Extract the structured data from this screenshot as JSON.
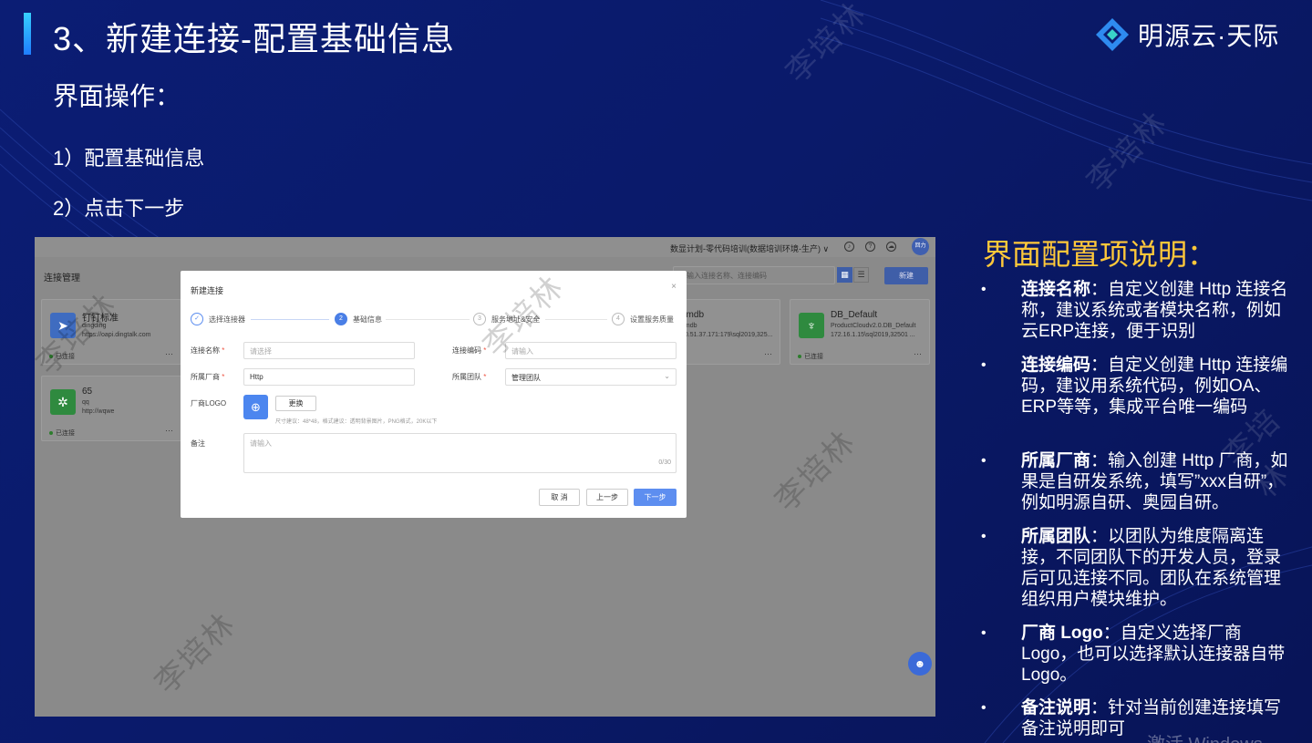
{
  "slide": {
    "title": "3、新建连接-配置基础信息",
    "brand_name": "明源云·天际",
    "subheading": "界面操作：",
    "steps": [
      "1）配置基础信息",
      "2）点击下一步"
    ],
    "watermark": "李培林",
    "activate_text": "激活 Windows"
  },
  "app": {
    "project_selector": "数显计划-零代码培训(数据培训环境-生产) ∨",
    "avatar_text": "回力",
    "page_title": "连接管理",
    "search_placeholder": "输入连接名称、连接编码",
    "new_button": "新建",
    "cards": [
      {
        "name": "钉钉标准",
        "line2": "dingding",
        "line3": "https://oapi.dingtalk.com",
        "status": "已连接",
        "icon_color": "#3f6cc0",
        "icon_glyph": "➤"
      },
      {
        "name": "pmdb",
        "line2": "pmdb",
        "line3": "10.51.37.171:179\\sql2019,325...",
        "status": "",
        "icon_color": "#2f8a3f",
        "icon_glyph": "♆"
      },
      {
        "name": "DB_Default",
        "line2": "ProductCloudv2.0.DB_Default",
        "line3": "172.16.1.15\\sql2019,32501 ...",
        "status": "已连接",
        "icon_color": "#2f8a3f",
        "icon_glyph": "♆"
      },
      {
        "name": "65",
        "line2": "qq",
        "line3": "http://wqwe",
        "status": "已连接",
        "icon_color": "#2f8a3f",
        "icon_glyph": "✲"
      }
    ],
    "more": "···"
  },
  "modal": {
    "title": "新建连接",
    "close": "×",
    "steps": [
      {
        "label": "选择连接器",
        "mark": "✓",
        "state": "done"
      },
      {
        "label": "基础信息",
        "mark": "2",
        "state": "active"
      },
      {
        "label": "服务地址&安全",
        "mark": "3",
        "state": "todo"
      },
      {
        "label": "设置服务质量",
        "mark": "4",
        "state": "todo"
      }
    ],
    "fields": {
      "name_label": "连接名称",
      "name_placeholder": "请选择",
      "code_label": "连接编码",
      "code_placeholder": "请输入",
      "vendor_label": "所属厂商",
      "vendor_value": "Http",
      "team_label": "所属团队",
      "team_value": "管理团队",
      "logo_label": "厂商LOGO",
      "swap_button": "更换",
      "logo_hint": "尺寸建议：48*48，格式建议：透明背景图片，PNG格式，20K以下",
      "remark_label": "备注",
      "remark_placeholder": "请输入",
      "remark_count": "0/30"
    },
    "buttons": {
      "cancel": "取 消",
      "prev": "上一步",
      "next": "下一步"
    }
  },
  "explain": {
    "heading": "界面配置项说明：",
    "items": [
      {
        "term": "连接名称",
        "text": "：自定义创建 Http 连接名称，建议系统或者模块名称，例如云ERP连接，便于识别"
      },
      {
        "term": "连接编码",
        "text": "：自定义创建 Http 连接编码，建议用系统代码，例如OA、ERP等等，集成平台唯一编码"
      },
      {
        "term": "所属厂商",
        "text": "：输入创建 Http 厂商，如果是自研发系统，填写”xxx自研”，例如明源自研、奥园自研。"
      },
      {
        "term": "所属团队",
        "text": "：以团队为维度隔离连接，不同团队下的开发人员，登录后可见连接不同。团队在系统管理组织用户模块维护。"
      },
      {
        "term": "厂商 Logo",
        "text": "：自定义选择厂商Logo，也可以选择默认连接器自带 Logo。"
      },
      {
        "term": "备注说明",
        "text": "：针对当前创建连接填写备注说明即可"
      }
    ]
  },
  "colors": {
    "accent": "#ffc83a",
    "primary_button": "#5d8ef0",
    "background": "#0b1d74"
  }
}
